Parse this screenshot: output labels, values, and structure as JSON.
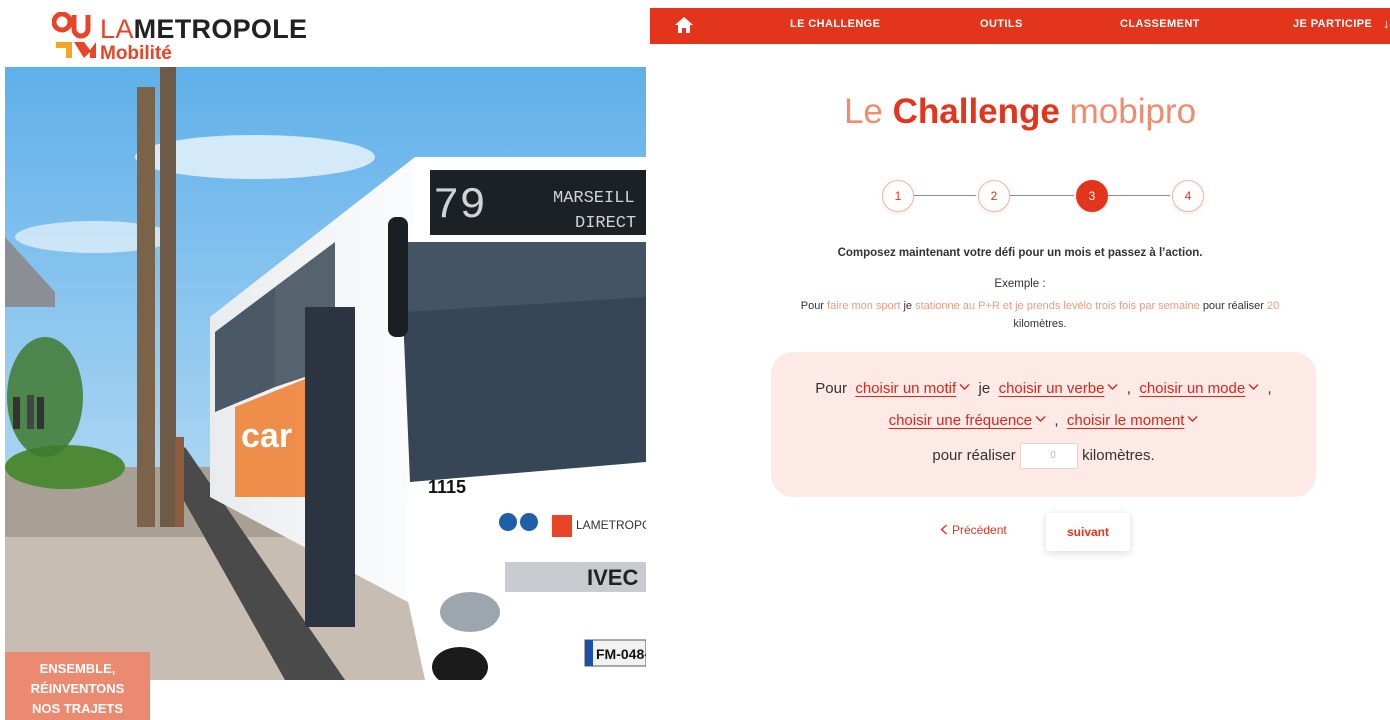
{
  "brand": {
    "la": "LA",
    "metropole": "METROPOLE",
    "sub": "Mobilité"
  },
  "photo": {
    "bus_route_number": "79",
    "bus_destination_line1": "MARSEILL",
    "bus_destination_line2": "DIRECT",
    "bus_fleet_number": "1115",
    "bus_plate": "FM-048-",
    "bus_brand": "IVEC",
    "bus_livery_text": "car"
  },
  "slogan": {
    "line1": "ENSEMBLE,",
    "line2": "RÉINVENTONS",
    "line3": "NOS TRAJETS"
  },
  "nav": {
    "home_icon": "home-icon",
    "items": [
      {
        "label": "LE CHALLENGE"
      },
      {
        "label": "OUTILS"
      },
      {
        "label": "CLASSEMENT"
      },
      {
        "label": "JE PARTICIPE"
      }
    ],
    "arrow": "↓"
  },
  "page": {
    "title_pre": "Le",
    "title_bold": "Challenge",
    "title_post": "mobipro"
  },
  "stepper": {
    "steps": [
      "1",
      "2",
      "3",
      "4"
    ],
    "active_step": 3
  },
  "intro": "Composez maintenant votre défi pour un mois et passez à l’action.",
  "example": {
    "heading": "Exemple :",
    "w1": "Pour",
    "h1": "faire mon sport",
    "w2": "je",
    "h2": "stationne au P+R et je prends levélo trois fois par semaine",
    "w3": "pour réaliser",
    "h3": "20",
    "w4": "kilomètres."
  },
  "form": {
    "pour": "Pour",
    "motif": "choisir un motif",
    "je": "je",
    "verbe": "choisir un verbe",
    "comma1": ",",
    "mode": "choisir un mode",
    "comma2": ",",
    "frequence": "choisir une fréquence",
    "comma3": ",",
    "moment": "choisir le moment",
    "pour_realiser": "pour réaliser",
    "km_placeholder": "0",
    "kilometres": "kilomètres."
  },
  "actions": {
    "prev_label": "Précédent",
    "next_label": "suivant"
  },
  "colors": {
    "accent": "#e3341c",
    "accent_light": "#ef8c6e",
    "card_bg": "#fde9e5",
    "slogan_bg": "#ea8a70"
  }
}
